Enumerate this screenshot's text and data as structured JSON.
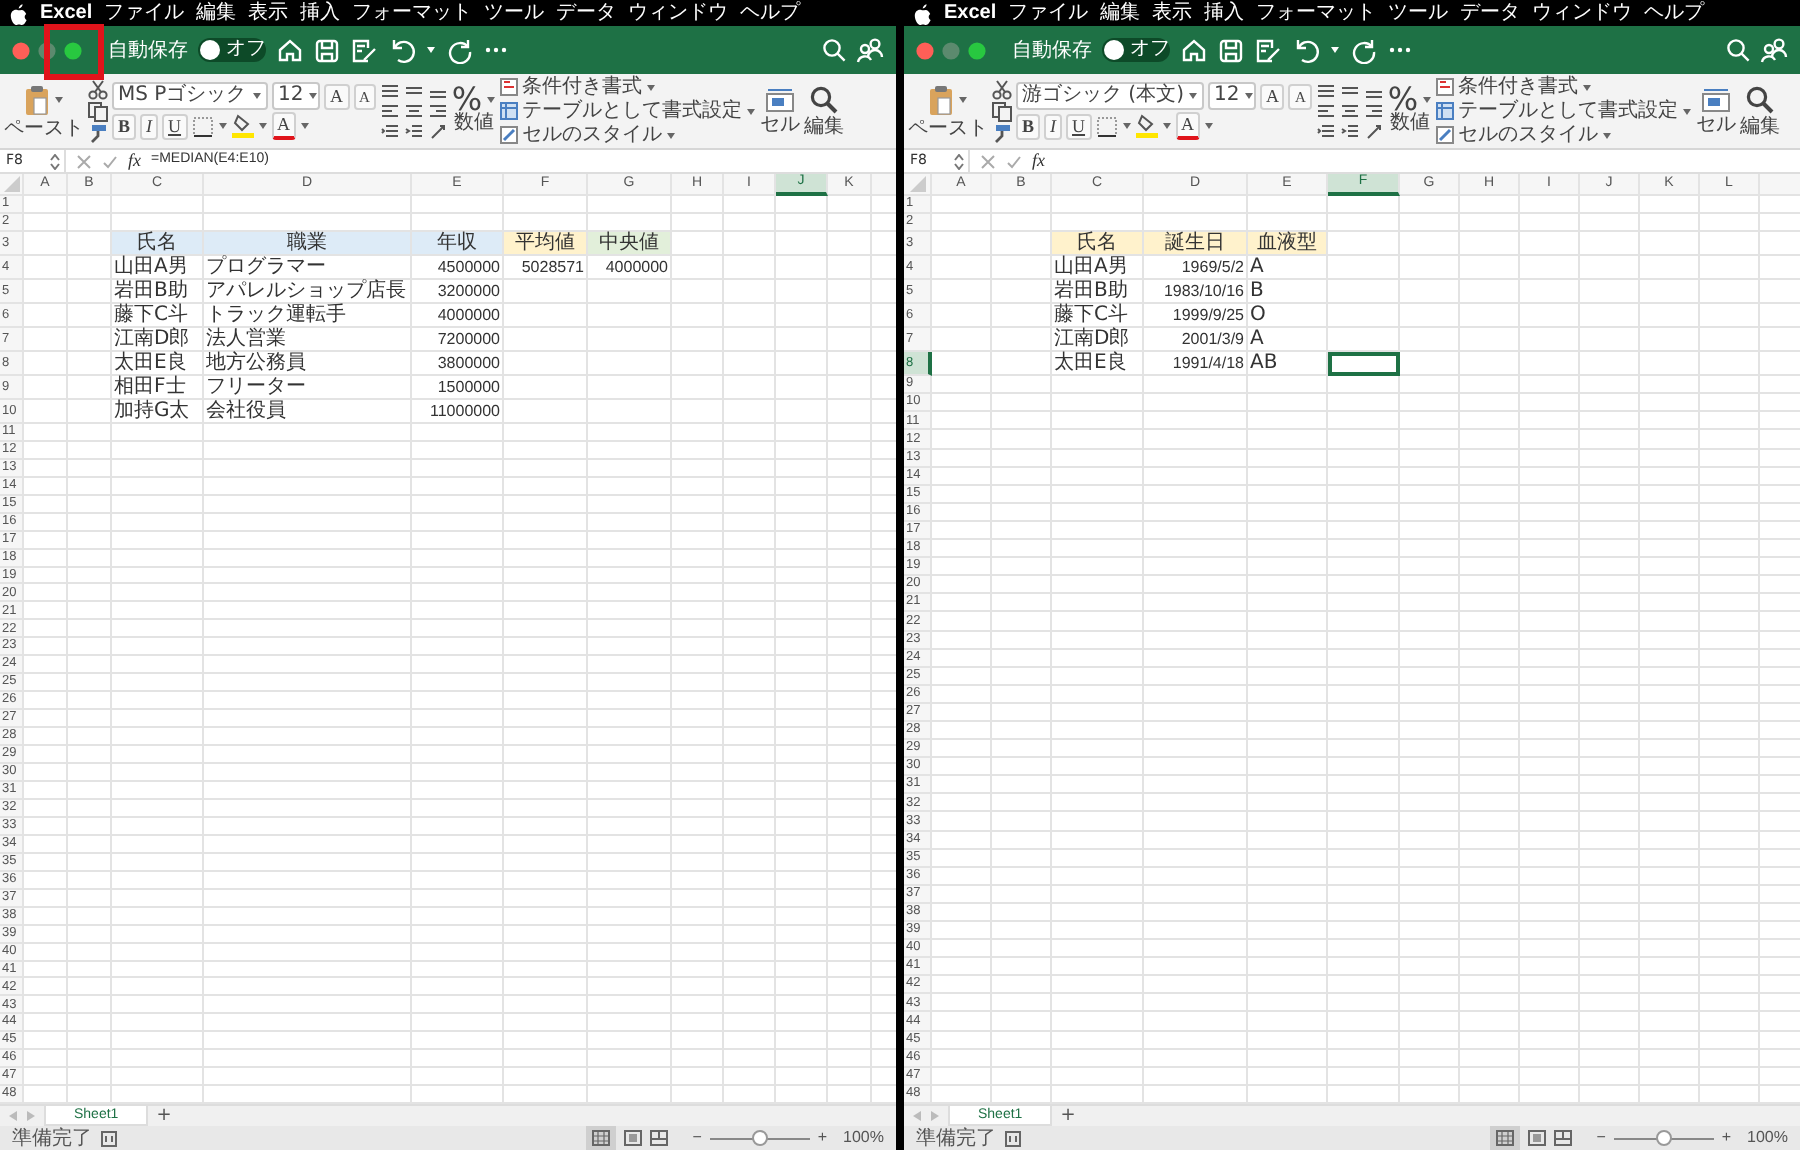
{
  "windows": [
    {
      "menu_bar": {
        "app": "Excel",
        "items": [
          "ファイル",
          "編集",
          "表示",
          "挿入",
          "フォーマット",
          "ツール",
          "データ",
          "ウィンドウ",
          "ヘルプ"
        ]
      },
      "title_bar": {
        "highlight_frame": true,
        "lights": [
          {
            "kind": "close",
            "disabled": false
          },
          {
            "kind": "minimize",
            "disabled": true
          },
          {
            "kind": "zoom",
            "disabled": false
          }
        ],
        "autosave_label": "自動保存",
        "autosave_toggle": {
          "label": "オフ",
          "on": false
        }
      },
      "ribbon": {
        "paste_label": "ペースト",
        "font_name": "MS Pゴシック",
        "font_size": "12",
        "size_buttons": [
          {
            "kind": "grow",
            "label": "A"
          },
          {
            "kind": "shrink",
            "label": "A"
          }
        ],
        "style_buttons": [
          {
            "kind": "bold",
            "label": "B"
          },
          {
            "kind": "italic",
            "label": "I"
          },
          {
            "kind": "underline",
            "label": "U"
          }
        ],
        "font_color_label": "A",
        "number_symbol": "%",
        "number_label": "数値",
        "style_items": [
          "条件付き書式",
          "テーブルとして書式設定",
          "セルのスタイル"
        ],
        "cells_label": "セル",
        "editing_label": "編集"
      },
      "formula_bar": {
        "name_box": "F8",
        "fx_label": "fx",
        "formula": "=MEDIAN(E4:E10)"
      },
      "sheet": {
        "columns": [
          {
            "label": "A",
            "selected": false
          },
          {
            "label": "B",
            "selected": false
          },
          {
            "label": "C",
            "selected": false
          },
          {
            "label": "D",
            "selected": false
          },
          {
            "label": "E",
            "selected": false
          },
          {
            "label": "F",
            "selected": false
          },
          {
            "label": "G",
            "selected": false
          },
          {
            "label": "H",
            "selected": false
          },
          {
            "label": "I",
            "selected": false
          },
          {
            "label": "J",
            "selected": true
          },
          {
            "label": "K",
            "selected": false
          }
        ],
        "rows": [
          {
            "label": "1",
            "selected": false
          },
          {
            "label": "2",
            "selected": false
          },
          {
            "label": "3",
            "selected": false,
            "cells": [
              null,
              null,
              {
                "kind": "header",
                "text": "氏名",
                "color": "#ddebf7",
                "active": false
              },
              {
                "kind": "header",
                "text": "職業",
                "color": "#ddebf7",
                "active": false
              },
              {
                "kind": "header",
                "text": "年収",
                "color": "#ddebf7",
                "active": false
              },
              {
                "kind": "header",
                "text": "平均値",
                "color": "#fff2cc",
                "active": false
              },
              {
                "kind": "header",
                "text": "中央値",
                "color": "#e2efda",
                "active": false
              }
            ]
          },
          {
            "label": "4",
            "selected": false,
            "cells": [
              null,
              null,
              {
                "kind": "text",
                "text": "山田A男",
                "active": false
              },
              {
                "kind": "text",
                "text": "プログラマー",
                "active": false
              },
              {
                "kind": "number",
                "text": "4500000",
                "active": false
              },
              {
                "kind": "number",
                "text": "5028571",
                "active": false
              },
              {
                "kind": "number",
                "text": "4000000",
                "active": false
              }
            ]
          },
          {
            "label": "5",
            "selected": false,
            "cells": [
              null,
              null,
              {
                "kind": "text",
                "text": "岩田B助",
                "active": false
              },
              {
                "kind": "text",
                "text": "アパレルショップ店長",
                "active": false
              },
              {
                "kind": "number",
                "text": "3200000",
                "active": false
              }
            ]
          },
          {
            "label": "6",
            "selected": false,
            "cells": [
              null,
              null,
              {
                "kind": "text",
                "text": "藤下C斗",
                "active": false
              },
              {
                "kind": "text",
                "text": "トラック運転手",
                "active": false
              },
              {
                "kind": "number",
                "text": "4000000",
                "active": false
              }
            ]
          },
          {
            "label": "7",
            "selected": false,
            "cells": [
              null,
              null,
              {
                "kind": "text",
                "text": "江南D郎",
                "active": false
              },
              {
                "kind": "text",
                "text": "法人営業",
                "active": false
              },
              {
                "kind": "number",
                "text": "7200000",
                "active": false
              }
            ]
          },
          {
            "label": "8",
            "selected": false,
            "cells": [
              null,
              null,
              {
                "kind": "text",
                "text": "太田E良",
                "active": false
              },
              {
                "kind": "text",
                "text": "地方公務員",
                "active": false
              },
              {
                "kind": "number",
                "text": "3800000",
                "active": false
              }
            ]
          },
          {
            "label": "9",
            "selected": false,
            "cells": [
              null,
              null,
              {
                "kind": "text",
                "text": "相田F士",
                "active": false
              },
              {
                "kind": "text",
                "text": "フリーター",
                "active": false
              },
              {
                "kind": "number",
                "text": "1500000",
                "active": false
              }
            ]
          },
          {
            "label": "10",
            "selected": false,
            "cells": [
              null,
              null,
              {
                "kind": "text",
                "text": "加持G太",
                "active": false
              },
              {
                "kind": "text",
                "text": "会社役員",
                "active": false
              },
              {
                "kind": "number",
                "text": "11000000",
                "active": false
              }
            ]
          },
          {
            "label": "11",
            "selected": false
          },
          {
            "label": "12",
            "selected": false
          },
          {
            "label": "13",
            "selected": false
          },
          {
            "label": "14",
            "selected": false
          },
          {
            "label": "15",
            "selected": false
          },
          {
            "label": "16",
            "selected": false
          },
          {
            "label": "17",
            "selected": false
          },
          {
            "label": "18",
            "selected": false
          },
          {
            "label": "19",
            "selected": false
          },
          {
            "label": "20",
            "selected": false
          },
          {
            "label": "21",
            "selected": false
          },
          {
            "label": "22",
            "selected": false
          },
          {
            "label": "23",
            "selected": false
          },
          {
            "label": "24",
            "selected": false
          },
          {
            "label": "25",
            "selected": false
          },
          {
            "label": "26",
            "selected": false
          },
          {
            "label": "27",
            "selected": false
          },
          {
            "label": "28",
            "selected": false
          },
          {
            "label": "29",
            "selected": false
          },
          {
            "label": "30",
            "selected": false
          },
          {
            "label": "31",
            "selected": false
          },
          {
            "label": "32",
            "selected": false
          },
          {
            "label": "33",
            "selected": false
          },
          {
            "label": "34",
            "selected": false
          },
          {
            "label": "35",
            "selected": false
          },
          {
            "label": "36",
            "selected": false
          },
          {
            "label": "37",
            "selected": false
          },
          {
            "label": "38",
            "selected": false
          },
          {
            "label": "39",
            "selected": false
          },
          {
            "label": "40",
            "selected": false
          },
          {
            "label": "41",
            "selected": false
          },
          {
            "label": "42",
            "selected": false
          },
          {
            "label": "43",
            "selected": false
          },
          {
            "label": "44",
            "selected": false
          },
          {
            "label": "45",
            "selected": false
          },
          {
            "label": "46",
            "selected": false
          },
          {
            "label": "47",
            "selected": false
          },
          {
            "label": "48",
            "selected": false
          }
        ]
      },
      "sheet_tabs": [
        {
          "label": "Sheet1",
          "selected": true
        }
      ],
      "add_sheet": "+",
      "status_bar": {
        "text": "準備完了",
        "zoom_minus": "−",
        "zoom_plus": "+",
        "zoom_slider": {
          "level": 0.5
        },
        "zoom_text": "100%"
      }
    },
    {
      "menu_bar": {
        "app": "Excel",
        "items": [
          "ファイル",
          "編集",
          "表示",
          "挿入",
          "フォーマット",
          "ツール",
          "データ",
          "ウィンドウ",
          "ヘルプ"
        ]
      },
      "title_bar": {
        "highlight_frame": false,
        "lights": [
          {
            "kind": "close",
            "disabled": false
          },
          {
            "kind": "minimize",
            "disabled": true
          },
          {
            "kind": "zoom",
            "disabled": false
          }
        ],
        "autosave_label": "自動保存",
        "autosave_toggle": {
          "label": "オフ",
          "on": false
        }
      },
      "ribbon": {
        "paste_label": "ペースト",
        "font_name": "游ゴシック (本文)",
        "font_size": "12",
        "size_buttons": [
          {
            "kind": "grow",
            "label": "A"
          },
          {
            "kind": "shrink",
            "label": "A"
          }
        ],
        "style_buttons": [
          {
            "kind": "bold",
            "label": "B"
          },
          {
            "kind": "italic",
            "label": "I"
          },
          {
            "kind": "underline",
            "label": "U"
          }
        ],
        "font_color_label": "A",
        "number_symbol": "%",
        "number_label": "数値",
        "style_items": [
          "条件付き書式",
          "テーブルとして書式設定",
          "セルのスタイル"
        ],
        "cells_label": "セル",
        "editing_label": "編集"
      },
      "formula_bar": {
        "name_box": "F8",
        "fx_label": "fx"
      },
      "sheet": {
        "columns": [
          {
            "label": "A",
            "selected": false
          },
          {
            "label": "B",
            "selected": false
          },
          {
            "label": "C",
            "selected": false
          },
          {
            "label": "D",
            "selected": false
          },
          {
            "label": "E",
            "selected": false
          },
          {
            "label": "F",
            "selected": true
          },
          {
            "label": "G",
            "selected": false
          },
          {
            "label": "H",
            "selected": false
          },
          {
            "label": "I",
            "selected": false
          },
          {
            "label": "J",
            "selected": false
          },
          {
            "label": "K",
            "selected": false
          },
          {
            "label": "L",
            "selected": false
          }
        ],
        "rows": [
          {
            "label": "1",
            "selected": false
          },
          {
            "label": "2",
            "selected": false
          },
          {
            "label": "3",
            "selected": false,
            "cells": [
              null,
              null,
              {
                "kind": "header",
                "text": "氏名",
                "color": "#fff2cc",
                "active": false
              },
              {
                "kind": "header",
                "text": "誕生日",
                "color": "#fff2cc",
                "active": false
              },
              {
                "kind": "header",
                "text": "血液型",
                "color": "#fff2cc",
                "active": false
              }
            ]
          },
          {
            "label": "4",
            "selected": false,
            "cells": [
              null,
              null,
              {
                "kind": "text",
                "text": "山田A男",
                "active": false
              },
              {
                "kind": "number",
                "text": "1969/5/2",
                "active": false
              },
              {
                "kind": "text",
                "text": "A",
                "active": false
              }
            ]
          },
          {
            "label": "5",
            "selected": false,
            "cells": [
              null,
              null,
              {
                "kind": "text",
                "text": "岩田B助",
                "active": false
              },
              {
                "kind": "number",
                "text": "1983/10/16",
                "active": false
              },
              {
                "kind": "text",
                "text": "B",
                "active": false
              }
            ]
          },
          {
            "label": "6",
            "selected": false,
            "cells": [
              null,
              null,
              {
                "kind": "text",
                "text": "藤下C斗",
                "active": false
              },
              {
                "kind": "number",
                "text": "1999/9/25",
                "active": false
              },
              {
                "kind": "text",
                "text": "O",
                "active": false
              }
            ]
          },
          {
            "label": "7",
            "selected": false,
            "cells": [
              null,
              null,
              {
                "kind": "text",
                "text": "江南D郎",
                "active": false
              },
              {
                "kind": "number",
                "text": "2001/3/9",
                "active": false
              },
              {
                "kind": "text",
                "text": "A",
                "active": false
              }
            ]
          },
          {
            "label": "8",
            "selected": true,
            "cells": [
              null,
              null,
              {
                "kind": "text",
                "text": "太田E良",
                "active": false
              },
              {
                "kind": "number",
                "text": "1991/4/18",
                "active": false
              },
              {
                "kind": "text",
                "text": "AB",
                "active": false
              },
              {
                "kind": "text",
                "active": true
              }
            ]
          },
          {
            "label": "9",
            "selected": false
          },
          {
            "label": "10",
            "selected": false
          },
          {
            "label": "11",
            "selected": false
          },
          {
            "label": "12",
            "selected": false
          },
          {
            "label": "13",
            "selected": false
          },
          {
            "label": "14",
            "selected": false
          },
          {
            "label": "15",
            "selected": false
          },
          {
            "label": "16",
            "selected": false
          },
          {
            "label": "17",
            "selected": false
          },
          {
            "label": "18",
            "selected": false
          },
          {
            "label": "19",
            "selected": false
          },
          {
            "label": "20",
            "selected": false
          },
          {
            "label": "21",
            "selected": false
          },
          {
            "label": "22",
            "selected": false
          },
          {
            "label": "23",
            "selected": false
          },
          {
            "label": "24",
            "selected": false
          },
          {
            "label": "25",
            "selected": false
          },
          {
            "label": "26",
            "selected": false
          },
          {
            "label": "27",
            "selected": false
          },
          {
            "label": "28",
            "selected": false
          },
          {
            "label": "29",
            "selected": false
          },
          {
            "label": "30",
            "selected": false
          },
          {
            "label": "31",
            "selected": false
          },
          {
            "label": "32",
            "selected": false
          },
          {
            "label": "33",
            "selected": false
          },
          {
            "label": "34",
            "selected": false
          },
          {
            "label": "35",
            "selected": false
          },
          {
            "label": "36",
            "selected": false
          },
          {
            "label": "37",
            "selected": false
          },
          {
            "label": "38",
            "selected": false
          },
          {
            "label": "39",
            "selected": false
          },
          {
            "label": "40",
            "selected": false
          },
          {
            "label": "41",
            "selected": false
          },
          {
            "label": "42",
            "selected": false
          },
          {
            "label": "43",
            "selected": false
          },
          {
            "label": "44",
            "selected": false
          },
          {
            "label": "45",
            "selected": false
          },
          {
            "label": "46",
            "selected": false
          },
          {
            "label": "47",
            "selected": false
          },
          {
            "label": "48",
            "selected": false
          }
        ]
      },
      "sheet_tabs": [
        {
          "label": "Sheet1",
          "selected": true
        }
      ],
      "add_sheet": "+",
      "status_bar": {
        "text": "準備完了",
        "zoom_minus": "−",
        "zoom_plus": "+",
        "zoom_slider": {
          "level": 0.5
        },
        "zoom_text": "100%"
      }
    }
  ]
}
